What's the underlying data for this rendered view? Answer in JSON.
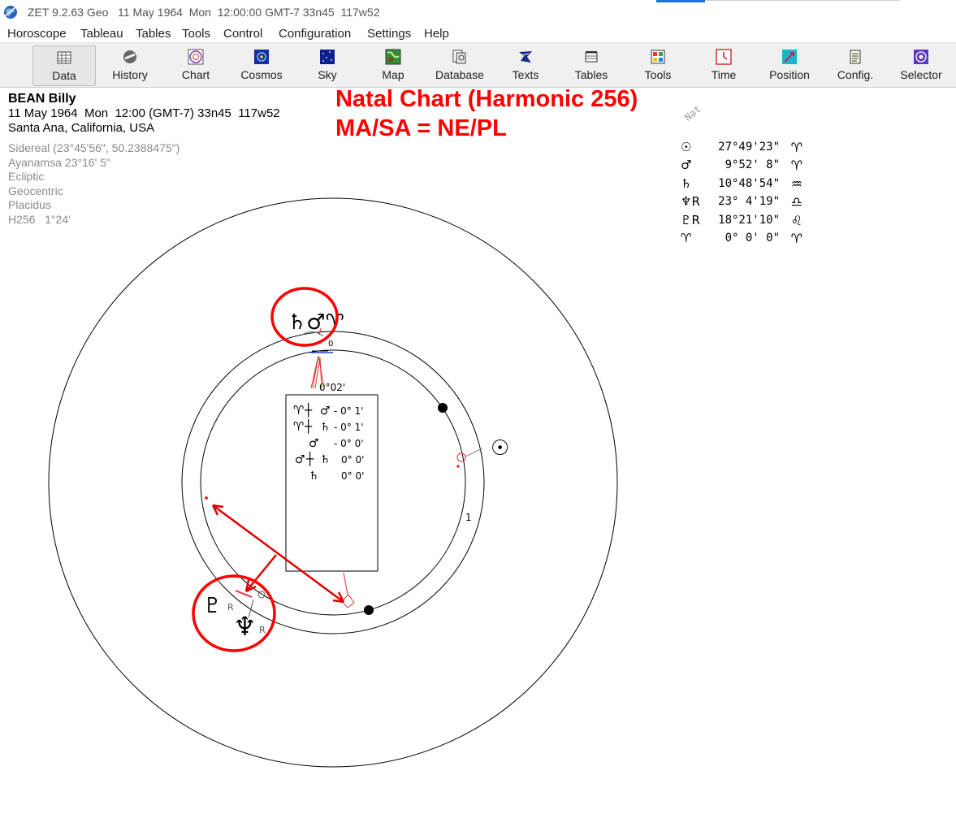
{
  "app_title": "ZET 9.2.63 Geo   11 May 1964  Mon  12:00:00 GMT-7 33n45  117w52",
  "menu": [
    "Horoscope",
    "Tableau",
    "Tables",
    "Tools",
    "Control",
    "Configuration",
    "Settings",
    "Help"
  ],
  "toolbar": [
    {
      "label": "Data",
      "icon": "data-grid-icon",
      "active": true
    },
    {
      "label": "History",
      "icon": "history-icon"
    },
    {
      "label": "Chart",
      "icon": "chart-icon"
    },
    {
      "label": "Cosmos",
      "icon": "cosmos-icon"
    },
    {
      "label": "Sky",
      "icon": "sky-icon"
    },
    {
      "label": "Map",
      "icon": "map-icon"
    },
    {
      "label": "Database",
      "icon": "database-icon"
    },
    {
      "label": "Texts",
      "icon": "texts-icon"
    },
    {
      "label": "Tables",
      "icon": "tables-icon"
    },
    {
      "label": "Tools",
      "icon": "tools-icon"
    },
    {
      "label": "Time",
      "icon": "time-icon"
    },
    {
      "label": "Position",
      "icon": "position-icon"
    },
    {
      "label": "Config.",
      "icon": "config-icon"
    },
    {
      "label": "Selector",
      "icon": "selector-icon"
    }
  ],
  "info": {
    "name": "BEAN Billy",
    "datetime": "11 May 1964  Mon  12:00 (GMT-7) 33n45  117w52",
    "place": "Santa Ana, California, USA",
    "settings": [
      "Sidereal (23°45'56\", 50.2388475\")",
      "Ayanamsa 23°16' 5\"",
      "Ecliptic",
      "Geocentric",
      "Placidus",
      "H256   1°24'"
    ]
  },
  "annotation": {
    "line1": "Natal Chart (Harmonic 256)",
    "line2": "MA/SA = NE/PL",
    "color": "#ff0000"
  },
  "positions": {
    "header": "Nat",
    "rows": [
      {
        "glyph": "☉",
        "value": "27°49'23\"",
        "sign": "♈"
      },
      {
        "glyph": "♂",
        "value": "9°52' 8\"",
        "sign": "♈"
      },
      {
        "glyph": "♄",
        "value": "10°48'54\"",
        "sign": "♒"
      },
      {
        "glyph": "♆R",
        "value": "23° 4'19\"",
        "sign": "♎"
      },
      {
        "glyph": "♇R",
        "value": "18°21'10\"",
        "sign": "♌"
      },
      {
        "glyph": "♈",
        "value": "0° 0' 0\"",
        "sign": "♈"
      }
    ]
  },
  "chart": {
    "orb_label": "0°02'",
    "aspect_box": [
      {
        "left": "♈",
        "mid": "♂",
        "val": "- 0° 1'"
      },
      {
        "left": "♈",
        "mid": "♄",
        "val": "- 0° 1'"
      },
      {
        "left": "",
        "mid": "♂",
        "val": "- 0° 0'"
      },
      {
        "left": "♂",
        "mid": "♄",
        "val": "0° 0'"
      },
      {
        "left": "",
        "mid": "♄",
        "val": "0° 0'"
      }
    ],
    "cluster_top": "♄♂♈",
    "sun_glyph": "☉",
    "pluto_glyph": "♇",
    "neptune_glyph": "♆",
    "retro": "R",
    "cusp_label": "1",
    "small_mark": "0"
  }
}
